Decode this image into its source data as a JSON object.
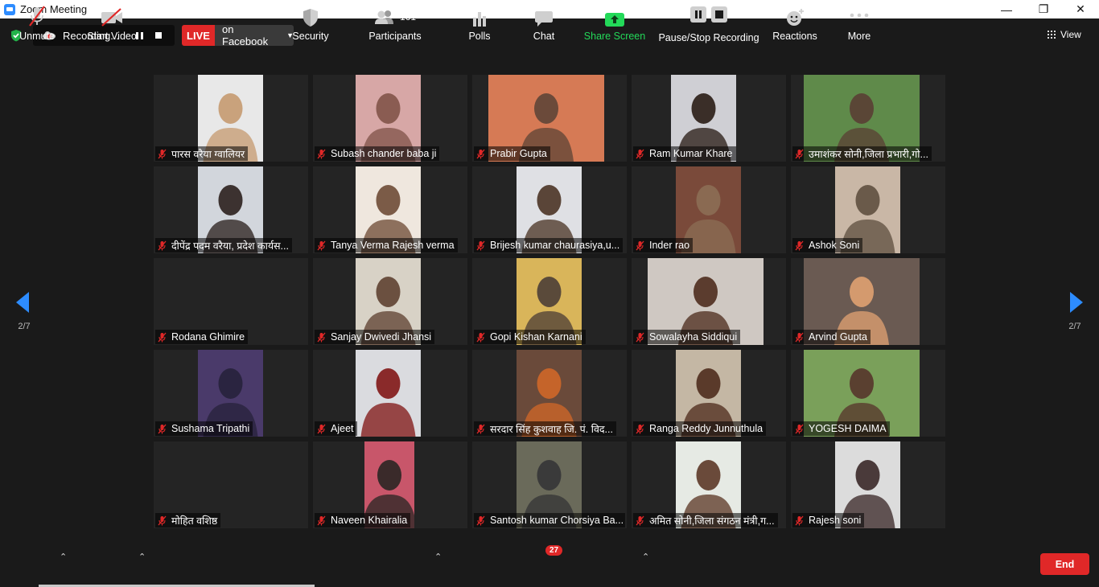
{
  "window": {
    "title": "Zoom Meeting",
    "minimize": "—",
    "restore": "❐",
    "close": "✕"
  },
  "topbar": {
    "recording_label": "Recording...",
    "live_label": "LIVE",
    "live_destination": "on Facebook",
    "view_label": "View"
  },
  "pager": {
    "left_page": "2/7",
    "right_page": "2/7"
  },
  "participants": [
    {
      "name": "पारस वरैया ग्वालियर",
      "video": "#c9a27c",
      "bg": "#e8e8e8"
    },
    {
      "name": "Subash chander baba ji",
      "video": "#8a5c52",
      "bg": "#d7a7a6"
    },
    {
      "name": "Prabir Gupta",
      "video": "#6b4a3a",
      "bg": "#d67a55"
    },
    {
      "name": "Ram Kumar Khare",
      "video": "#3a2e28",
      "bg": "#cfcfd4"
    },
    {
      "name": "उमाशंकर सोनी,जिला प्रभारी,गो...",
      "video": "#5a4636",
      "bg": "#5f8a4a"
    },
    {
      "name": "दीपेंद्र पदम वरैया, प्रदेश कार्यस...",
      "video": "#3c3230",
      "bg": "#d2d6dc"
    },
    {
      "name": "Tanya Verma Rajesh verma",
      "video": "#7b5b47",
      "bg": "#efe7de"
    },
    {
      "name": "Brijesh kumar chaurasiya,u...",
      "video": "#5a4538",
      "bg": "#dfe0e4"
    },
    {
      "name": "Inder rao",
      "video": "#8a6a52",
      "bg": "#7a4a3a"
    },
    {
      "name": "Ashok Soni",
      "video": "#6a5a4a",
      "bg": "#c9b7a6"
    },
    {
      "name": "Rodana Ghimire",
      "video": "",
      "bg": ""
    },
    {
      "name": "Sanjay Dwivedi Jhansi",
      "video": "#6b5040",
      "bg": "#d8d2c6"
    },
    {
      "name": "Gopi Kishan Karnani",
      "video": "#5a4a3a",
      "bg": "#d9b55a"
    },
    {
      "name": "Sowalayha Siddiqui",
      "video": "#5b3c2e",
      "bg": "#cfc8c2"
    },
    {
      "name": "Arvind Gupta",
      "video": "#d49a6e",
      "bg": "#6a5a52"
    },
    {
      "name": "Sushama Tripathi",
      "video": "#2a2440",
      "bg": "#4a3a6a"
    },
    {
      "name": "Ajeet",
      "video": "#8a2a2a",
      "bg": "#dadbdf"
    },
    {
      "name": "सरदार सिंह कुशवाह जि. पं. विद...",
      "video": "#c5642a",
      "bg": "#6a4a3a"
    },
    {
      "name": "Ranga Reddy Junnuthula",
      "video": "#5a3a2a",
      "bg": "#c4b7a4"
    },
    {
      "name": "YOGESH DAIMA",
      "video": "#5a4030",
      "bg": "#7aa05a"
    },
    {
      "name": "मोहित वशिष्ठ",
      "video": "",
      "bg": ""
    },
    {
      "name": "Naveen Khairalia",
      "video": "#3a2a2a",
      "bg": "#c8566a"
    },
    {
      "name": "Santosh kumar Chorsiya Ba...",
      "video": "#3a3a3a",
      "bg": "#6a6a5a"
    },
    {
      "name": "अमित सोनी,जिला संगठन मंत्री,ग...",
      "video": "#6a4a3a",
      "bg": "#e6eae4"
    },
    {
      "name": "Rajesh soni",
      "video": "#4a3a3a",
      "bg": "#dcdcdc"
    }
  ],
  "toolbar": {
    "unmute": "Unmute",
    "start_video": "Start Video",
    "security": "Security",
    "participants": "Participants",
    "participants_count": "161",
    "polls": "Polls",
    "chat": "Chat",
    "chat_badge": "27",
    "share_screen": "Share Screen",
    "pause_stop_recording": "Pause/Stop Recording",
    "reactions": "Reactions",
    "more": "More",
    "end": "End"
  },
  "colors": {
    "accent_blue": "#2d8cff",
    "live_red": "#e02828",
    "share_green": "#23d959",
    "end_red": "#e02828"
  }
}
